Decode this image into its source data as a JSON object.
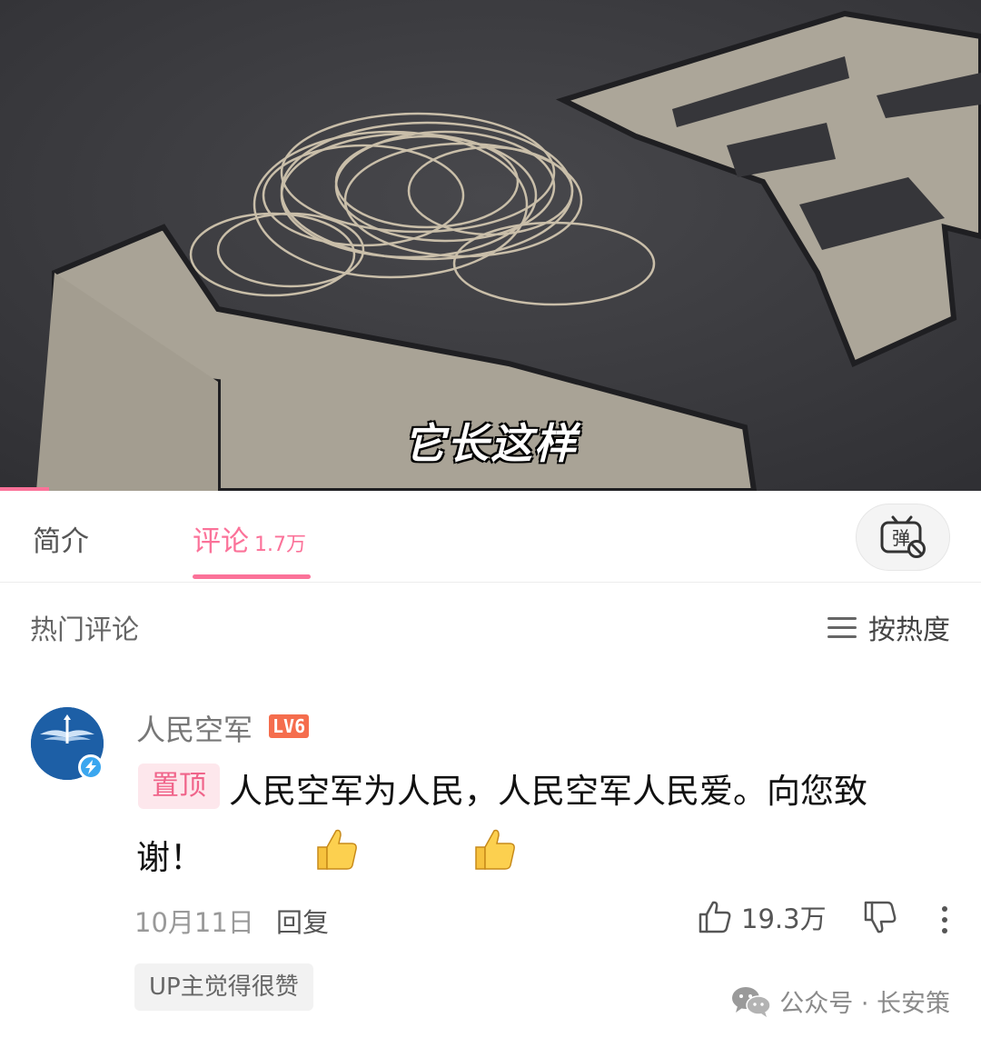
{
  "video": {
    "subtitle": "它长这样",
    "progress_fraction": 0.05
  },
  "tabs": {
    "intro_label": "简介",
    "comments_label": "评论",
    "comments_count": "1.7万",
    "danmaku_icon": "danmaku-off-icon",
    "danmaku_glyph": "弹"
  },
  "comments_header": {
    "title": "热门评论",
    "sort_label": "按热度",
    "sort_icon": "list-icon"
  },
  "comment": {
    "username": "人民空军",
    "level": "LV6",
    "pin_label": "置顶",
    "text": "人民空军为人民，人民空军人民爱。向您致谢！",
    "emojis": [
      "thumbs-up-icon",
      "thumbs-up-icon"
    ],
    "date": "10月11日",
    "reply_label": "回复",
    "like_count": "19.3万",
    "up_badge": "UP主觉得很赞",
    "avatar_text": "人民空军"
  },
  "watermark": {
    "text": "公众号 · 长安策",
    "icon": "wechat-icon"
  },
  "colors": {
    "accent": "#fb7299",
    "level_badge": "#f56d4d",
    "verified": "#3aa6ef"
  }
}
